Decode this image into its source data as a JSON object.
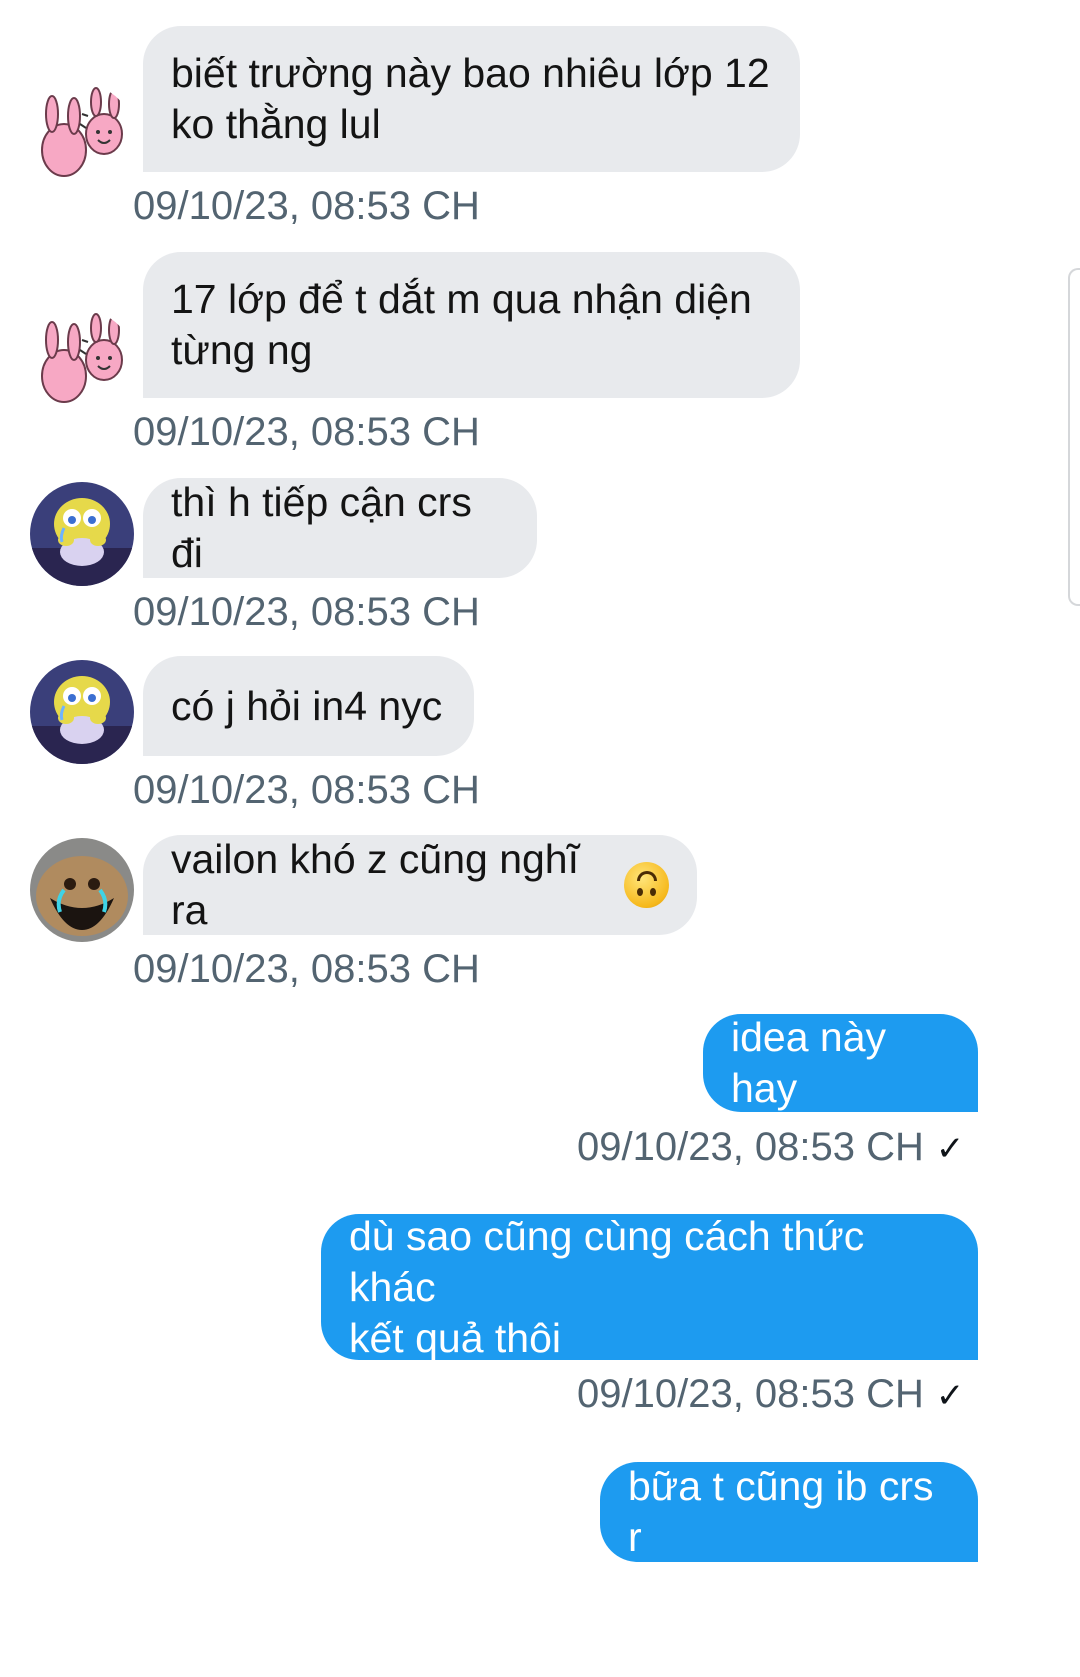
{
  "messages": [
    {
      "sender": "friend_a",
      "avatar": "pink-bunny-avatar",
      "text": "biết trường này bao nhiêu lớp 12\nko thằng lul",
      "time": "09/10/23, 08:53 CH"
    },
    {
      "sender": "friend_a",
      "avatar": "pink-bunny-avatar",
      "text": "17 lớp để t dắt m qua nhận diện\ntừng ng",
      "time": "09/10/23, 08:53 CH"
    },
    {
      "sender": "friend_b",
      "avatar": "spongebob-avatar",
      "text": "thì h tiếp cận crs đi",
      "time": "09/10/23, 08:53 CH"
    },
    {
      "sender": "friend_b",
      "avatar": "spongebob-avatar",
      "text": "có j hỏi in4 nyc",
      "time": "09/10/23, 08:53 CH"
    },
    {
      "sender": "friend_c",
      "avatar": "crying-face-avatar",
      "text": "vailon khó z cũng nghĩ ra",
      "emoji": "upside-down-face-emoji",
      "time": "09/10/23, 08:53 CH"
    },
    {
      "sender": "me",
      "text": "idea này hay",
      "time": "09/10/23, 08:53 CH",
      "status": "✓"
    },
    {
      "sender": "me",
      "text": "dù sao cũng cùng cách thức khác\nkết quả thôi",
      "time": "09/10/23, 08:53 CH",
      "status": "✓"
    },
    {
      "sender": "me",
      "text": "bữa t cũng ib crs r"
    }
  ],
  "colors": {
    "incoming_bubble": "#e8eaed",
    "outgoing_bubble": "#1d9bf0",
    "timestamp": "#536471"
  }
}
